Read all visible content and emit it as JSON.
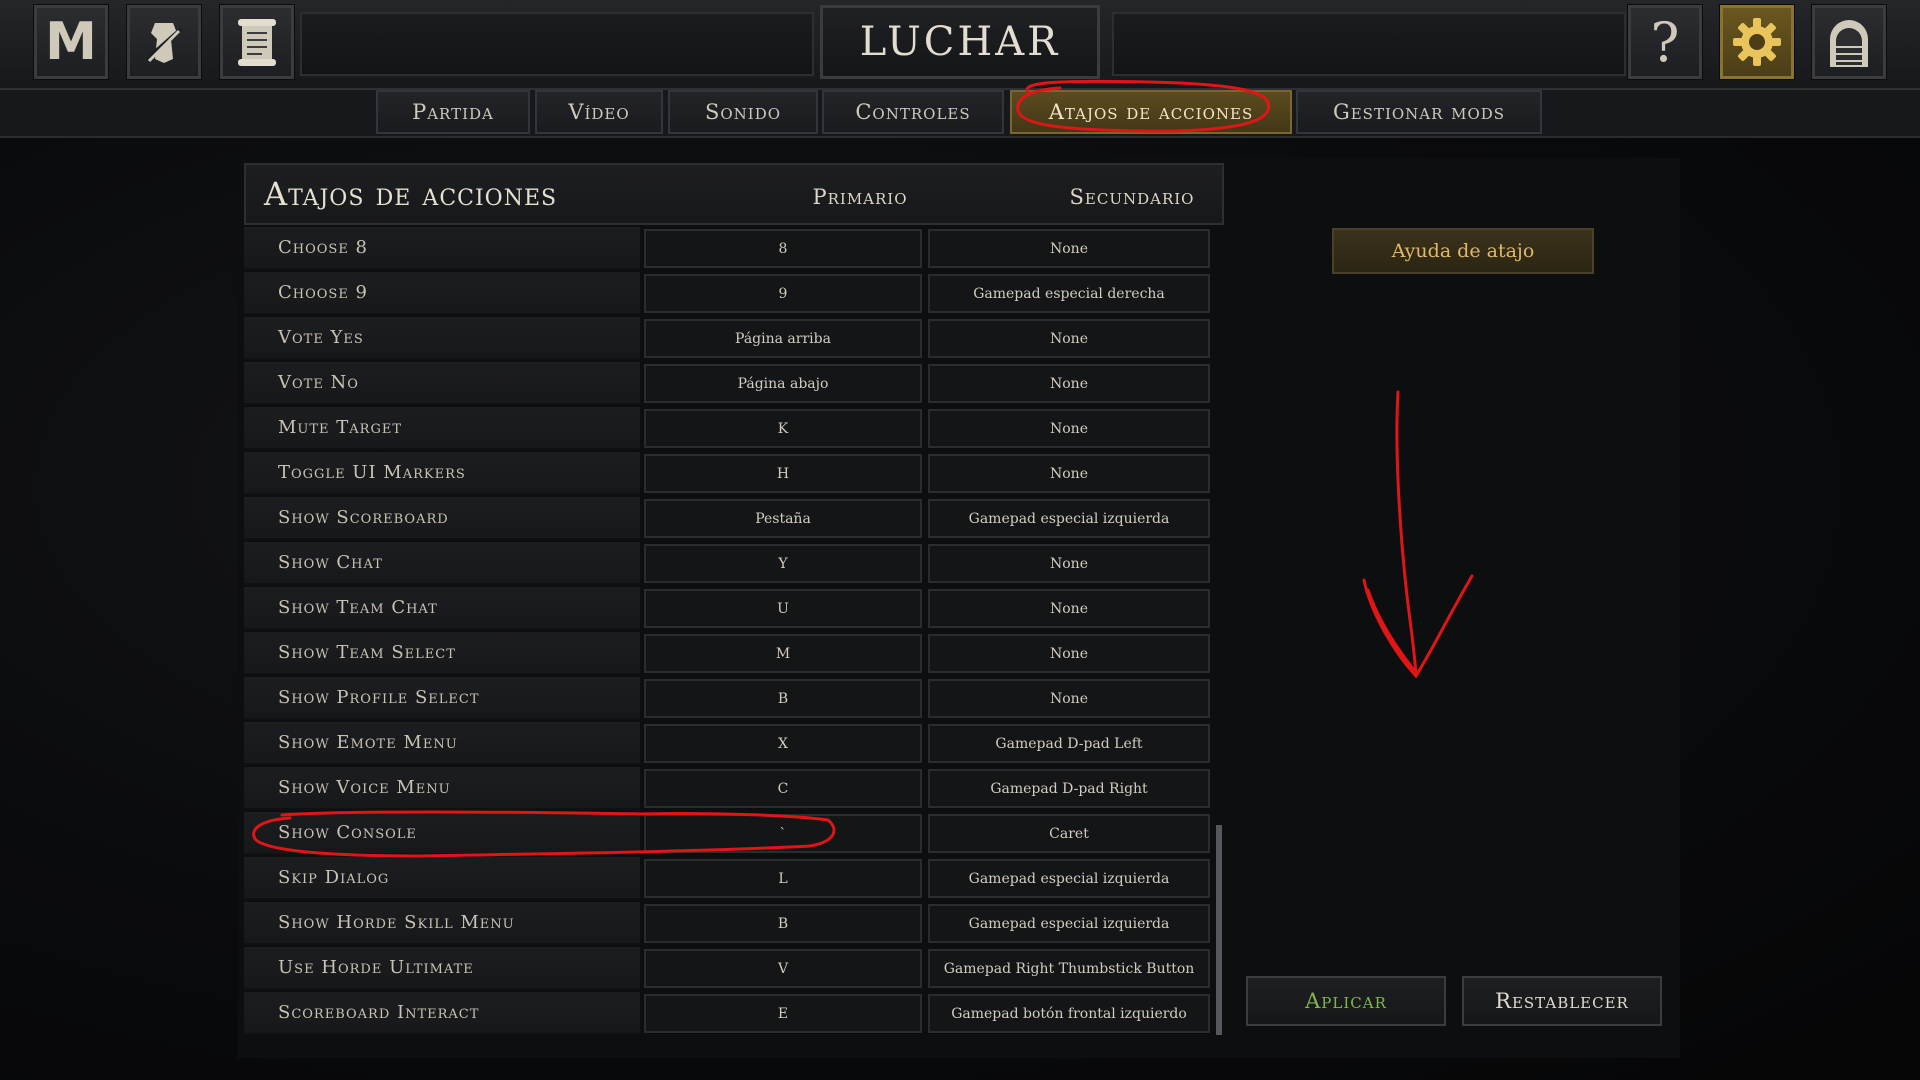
{
  "app": {
    "title": "LUCHAR"
  },
  "topbar": {
    "left_icons": [
      "m-logo-icon",
      "character-icon",
      "scroll-icon"
    ],
    "right_icons": [
      "help-icon",
      "gear-icon",
      "door-icon"
    ],
    "help_glyph": "?",
    "logo_glyph": "M"
  },
  "tabs": [
    {
      "label": "Partida",
      "active": false
    },
    {
      "label": "Vídeo",
      "active": false
    },
    {
      "label": "Sonido",
      "active": false
    },
    {
      "label": "Controles",
      "active": false
    },
    {
      "label": "Atajos de acciones",
      "active": true
    },
    {
      "label": "Gestionar mods",
      "active": false
    }
  ],
  "keybinds": {
    "title": "Atajos de acciones",
    "col_primary": "Primario",
    "col_secondary": "Secundario",
    "rows": [
      {
        "action": "Choose 8",
        "primary": "8",
        "secondary": "None"
      },
      {
        "action": "Choose 9",
        "primary": "9",
        "secondary": "Gamepad especial derecha"
      },
      {
        "action": "Vote Yes",
        "primary": "Página arriba",
        "secondary": "None"
      },
      {
        "action": "Vote No",
        "primary": "Página abajo",
        "secondary": "None"
      },
      {
        "action": "Mute Target",
        "primary": "K",
        "secondary": "None"
      },
      {
        "action": "Toggle UI Markers",
        "primary": "H",
        "secondary": "None"
      },
      {
        "action": "Show Scoreboard",
        "primary": "Pestaña",
        "secondary": "Gamepad especial izquierda"
      },
      {
        "action": "Show Chat",
        "primary": "Y",
        "secondary": "None"
      },
      {
        "action": "Show Team Chat",
        "primary": "U",
        "secondary": "None"
      },
      {
        "action": "Show Team Select",
        "primary": "M",
        "secondary": "None"
      },
      {
        "action": "Show Profile Select",
        "primary": "B",
        "secondary": "None"
      },
      {
        "action": "Show Emote Menu",
        "primary": "X",
        "secondary": "Gamepad D-pad Left"
      },
      {
        "action": "Show Voice Menu",
        "primary": "C",
        "secondary": "Gamepad D-pad Right"
      },
      {
        "action": "Show Console",
        "primary": "`",
        "secondary": "Caret"
      },
      {
        "action": "Skip Dialog",
        "primary": "L",
        "secondary": "Gamepad especial izquierda"
      },
      {
        "action": "Show Horde Skill Menu",
        "primary": "B",
        "secondary": "Gamepad especial izquierda"
      },
      {
        "action": "Use Horde Ultimate",
        "primary": "V",
        "secondary": "Gamepad Right Thumbstick Button"
      },
      {
        "action": "Scoreboard Interact",
        "primary": "E",
        "secondary": "Gamepad botón frontal izquierdo"
      }
    ]
  },
  "side": {
    "help_label": "Ayuda de atajo"
  },
  "footer": {
    "apply_label": "Aplicar",
    "reset_label": "Restablecer"
  },
  "colors": {
    "accent_gold": "#e2b965",
    "apply_green": "#7fb84a",
    "annotation_red": "#e01515"
  }
}
